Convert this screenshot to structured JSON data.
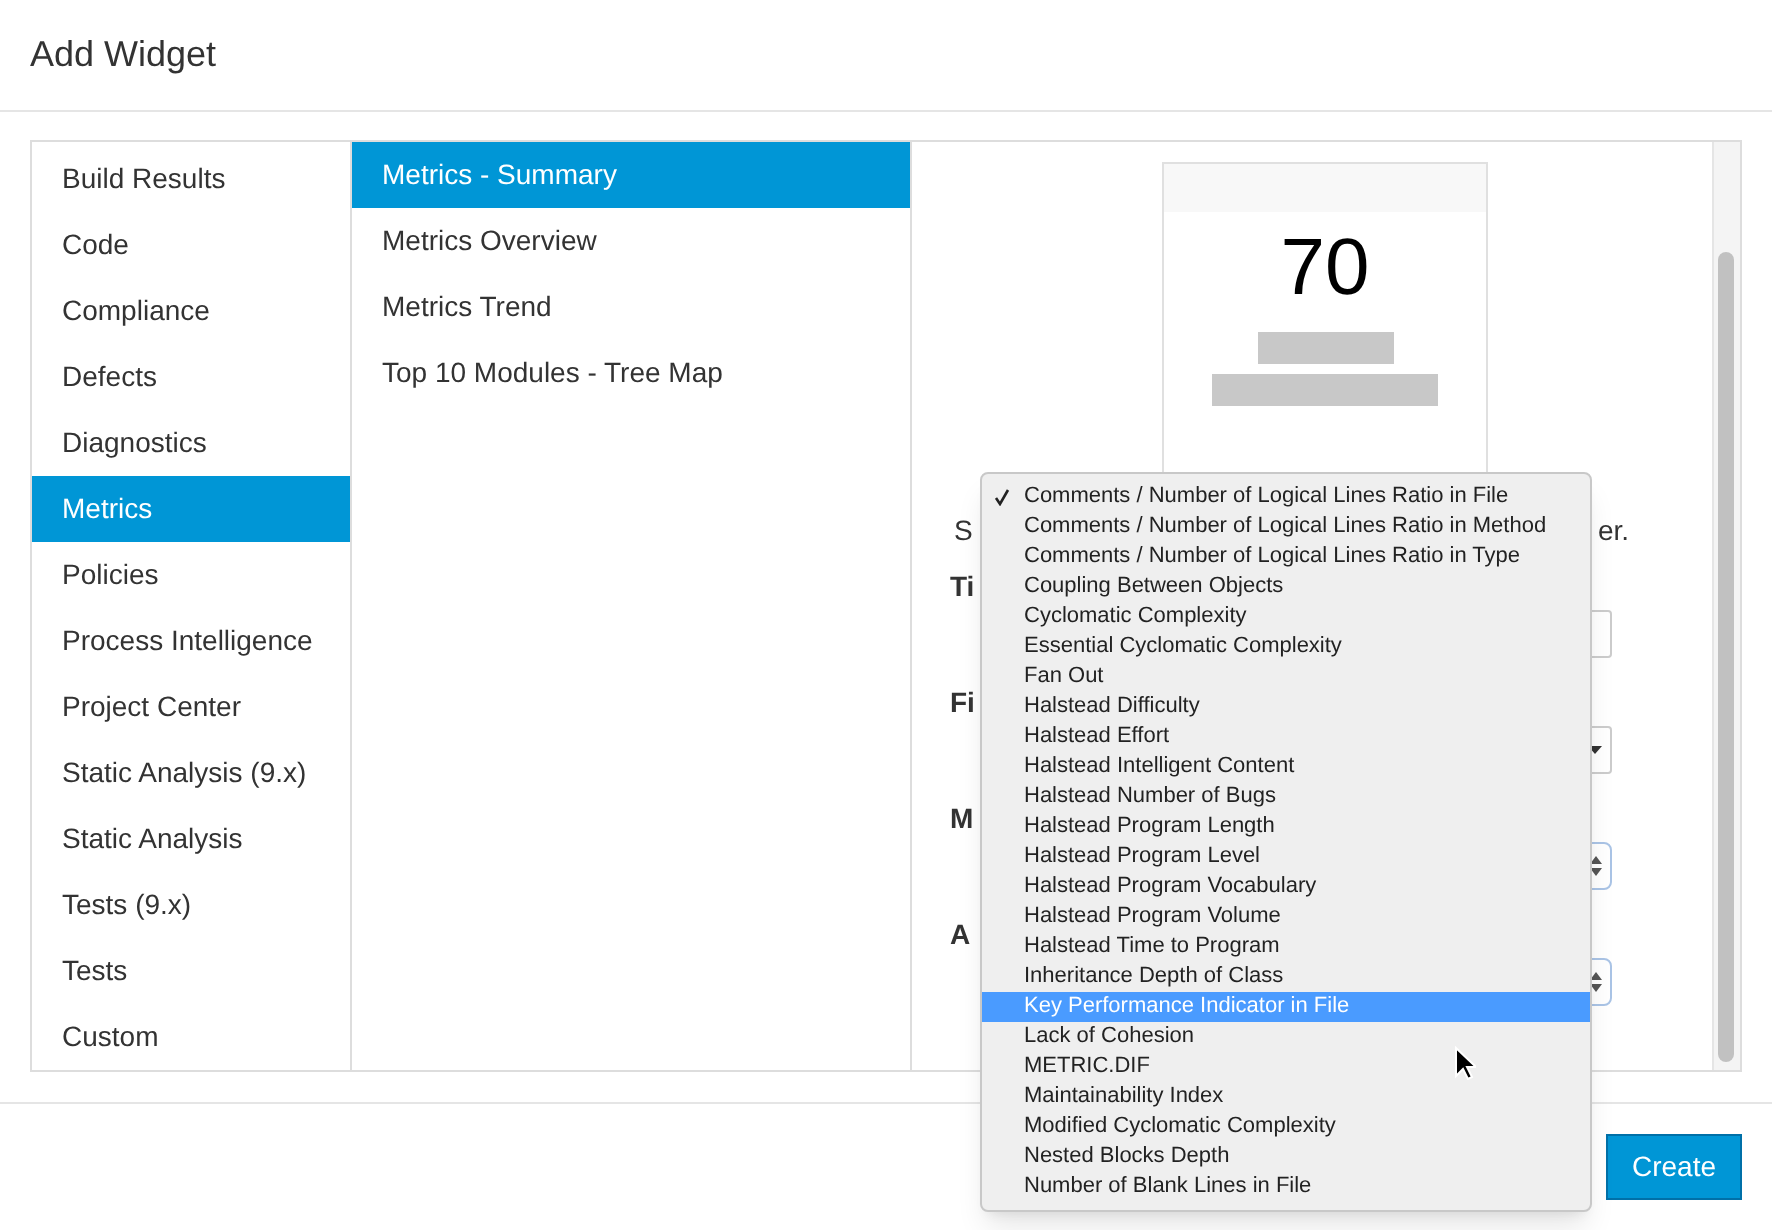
{
  "dialog": {
    "title": "Add Widget"
  },
  "categories": [
    {
      "label": "Build Results",
      "selected": false
    },
    {
      "label": "Code",
      "selected": false
    },
    {
      "label": "Compliance",
      "selected": false
    },
    {
      "label": "Defects",
      "selected": false
    },
    {
      "label": "Diagnostics",
      "selected": false
    },
    {
      "label": "Metrics",
      "selected": true
    },
    {
      "label": "Policies",
      "selected": false
    },
    {
      "label": "Process Intelligence",
      "selected": false
    },
    {
      "label": "Project Center",
      "selected": false
    },
    {
      "label": "Static Analysis (9.x)",
      "selected": false
    },
    {
      "label": "Static Analysis",
      "selected": false
    },
    {
      "label": "Tests (9.x)",
      "selected": false
    },
    {
      "label": "Tests",
      "selected": false
    },
    {
      "label": "Custom",
      "selected": false
    }
  ],
  "widgets": [
    {
      "label": "Metrics - Summary",
      "selected": true
    },
    {
      "label": "Metrics Overview",
      "selected": false
    },
    {
      "label": "Metrics Trend",
      "selected": false
    },
    {
      "label": "Top 10 Modules - Tree Map",
      "selected": false
    }
  ],
  "preview": {
    "value": "70"
  },
  "form_fragments": {
    "description_start": "S",
    "description_end": "er.",
    "labels": [
      "Ti",
      "Fi",
      "M",
      "A"
    ]
  },
  "metric_menu": [
    {
      "label": "Comments / Number of Logical Lines Ratio in File",
      "checked": true,
      "selected": false
    },
    {
      "label": "Comments / Number of Logical Lines Ratio in Method",
      "checked": false,
      "selected": false
    },
    {
      "label": "Comments / Number of Logical Lines Ratio in Type",
      "checked": false,
      "selected": false
    },
    {
      "label": "Coupling Between Objects",
      "checked": false,
      "selected": false
    },
    {
      "label": "Cyclomatic Complexity",
      "checked": false,
      "selected": false
    },
    {
      "label": "Essential Cyclomatic Complexity",
      "checked": false,
      "selected": false
    },
    {
      "label": "Fan Out",
      "checked": false,
      "selected": false
    },
    {
      "label": "Halstead Difficulty",
      "checked": false,
      "selected": false
    },
    {
      "label": "Halstead Effort",
      "checked": false,
      "selected": false
    },
    {
      "label": "Halstead Intelligent Content",
      "checked": false,
      "selected": false
    },
    {
      "label": "Halstead Number of Bugs",
      "checked": false,
      "selected": false
    },
    {
      "label": "Halstead Program Length",
      "checked": false,
      "selected": false
    },
    {
      "label": "Halstead Program Level",
      "checked": false,
      "selected": false
    },
    {
      "label": "Halstead Program Vocabulary",
      "checked": false,
      "selected": false
    },
    {
      "label": "Halstead Program Volume",
      "checked": false,
      "selected": false
    },
    {
      "label": "Halstead Time to Program",
      "checked": false,
      "selected": false
    },
    {
      "label": "Inheritance Depth of Class",
      "checked": false,
      "selected": false
    },
    {
      "label": "Key Performance Indicator in File",
      "checked": false,
      "selected": true
    },
    {
      "label": "Lack of Cohesion",
      "checked": false,
      "selected": false
    },
    {
      "label": "METRIC.DIF",
      "checked": false,
      "selected": false
    },
    {
      "label": "Maintainability Index",
      "checked": false,
      "selected": false
    },
    {
      "label": "Modified Cyclomatic Complexity",
      "checked": false,
      "selected": false
    },
    {
      "label": "Nested Blocks Depth",
      "checked": false,
      "selected": false
    },
    {
      "label": "Number of Blank Lines in File",
      "checked": false,
      "selected": false
    }
  ],
  "buttons": {
    "create": "Create"
  }
}
